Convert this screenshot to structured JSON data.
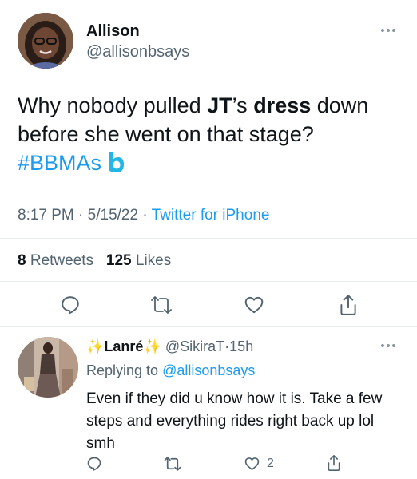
{
  "tweet": {
    "author_name": "Allison",
    "author_handle": "@allisonbsays",
    "text_parts": [
      "Why nobody pulled ",
      "JT",
      "’s ",
      "dress",
      " down before she went on that stage?"
    ],
    "hashtag": "#BBMAs",
    "time": "8:17 PM",
    "date": "5/15/22",
    "source": "Twitter for iPhone",
    "separator": "·",
    "retweets_count": "8",
    "retweets_label": "Retweets",
    "likes_count": "125",
    "likes_label": "Likes"
  },
  "reply": {
    "display_name": "Lanré",
    "sparkle": "✨",
    "handle": "@SikiraT",
    "separator": "·",
    "age": "15h",
    "replying_label": "Replying to",
    "replying_handle": "@allisonbsays",
    "text": "Even if they did u know how it is. Take a few steps and everything rides right back up lol smh",
    "likes_count": "2"
  },
  "icons": {
    "reply": "reply-icon",
    "retweet": "retweet-icon",
    "like": "heart-icon",
    "share": "share-icon",
    "more": "more-icon",
    "billboard": "billboard-logo"
  },
  "colors": {
    "accent": "#1d9bf0",
    "text": "#0f1419",
    "muted": "#536471",
    "billboard": "#23b7e5"
  }
}
